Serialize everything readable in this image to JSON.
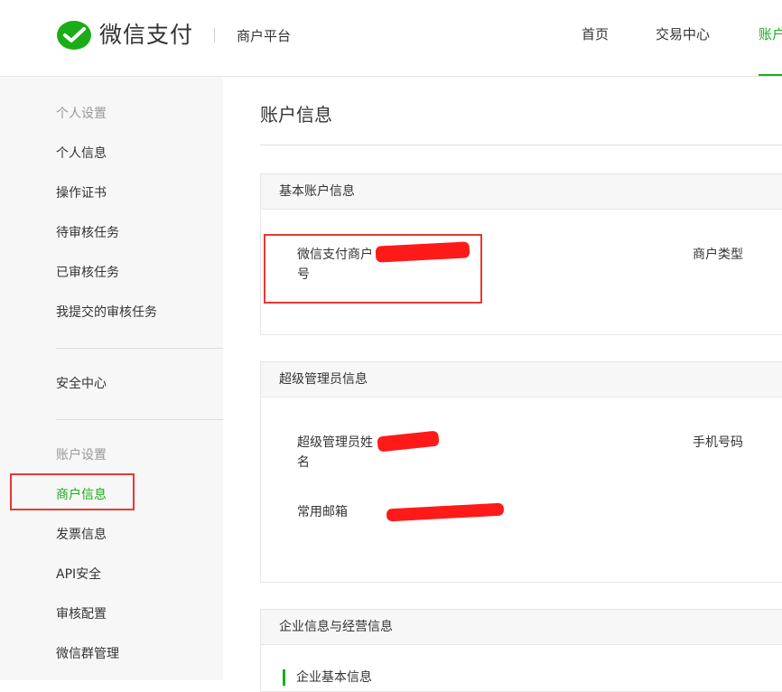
{
  "header": {
    "brand": "微信支付",
    "platform": "商户平台",
    "nav": [
      {
        "label": "首页",
        "active": false
      },
      {
        "label": "交易中心",
        "active": false
      },
      {
        "label": "账户",
        "active": true
      }
    ]
  },
  "sidebar": {
    "group_personal": "个人设置",
    "personal_items": [
      "个人信息",
      "操作证书",
      "待审核任务",
      "已审核任务",
      "我提交的审核任务"
    ],
    "security": "安全中心",
    "group_account": "账户设置",
    "account_items": [
      "商户信息",
      "发票信息",
      "API安全",
      "审核配置",
      "微信群管理"
    ]
  },
  "main": {
    "title": "账户信息",
    "basic": {
      "title": "基本账户信息",
      "merchant_id_label": "微信支付商户号",
      "merchant_type_label": "商户类型"
    },
    "admin": {
      "title": "超级管理员信息",
      "name_label": "超级管理员姓名",
      "phone_label": "手机号码",
      "email_label": "常用邮箱"
    },
    "enterprise": {
      "title": "企业信息与经营信息",
      "sub_title": "企业基本信息"
    }
  },
  "colors": {
    "accent": "#1aad19",
    "highlight": "#e53935",
    "redaction": "#ff1a1a"
  }
}
